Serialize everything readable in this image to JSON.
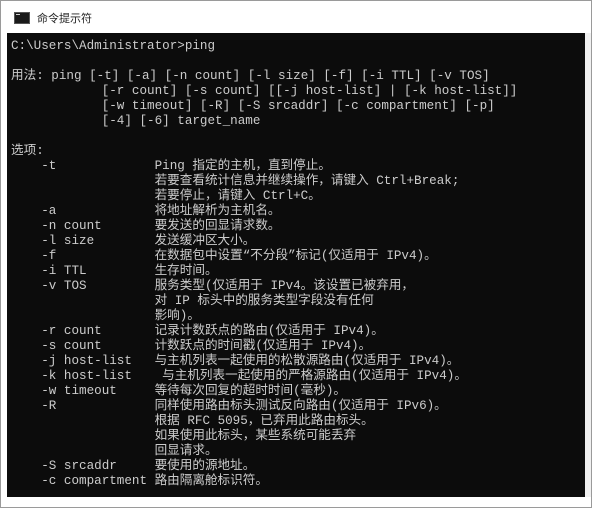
{
  "window": {
    "title": "命令提示符",
    "icon": "console-icon"
  },
  "console": {
    "lines": [
      "C:\\Users\\Administrator>ping",
      "",
      "用法: ping [-t] [-a] [-n count] [-l size] [-f] [-i TTL] [-v TOS]",
      "            [-r count] [-s count] [[-j host-list] | [-k host-list]]",
      "            [-w timeout] [-R] [-S srcaddr] [-c compartment] [-p]",
      "            [-4] [-6] target_name",
      "",
      "选项:",
      "    -t             Ping 指定的主机，直到停止。",
      "                   若要查看统计信息并继续操作，请键入 Ctrl+Break;",
      "                   若要停止，请键入 Ctrl+C。",
      "    -a             将地址解析为主机名。",
      "    -n count       要发送的回显请求数。",
      "    -l size        发送缓冲区大小。",
      "    -f             在数据包中设置“不分段”标记(仅适用于 IPv4)。",
      "    -i TTL         生存时间。",
      "    -v TOS         服务类型(仅适用于 IPv4。该设置已被弃用，",
      "                   对 IP 标头中的服务类型字段没有任何",
      "                   影响)。",
      "    -r count       记录计数跃点的路由(仅适用于 IPv4)。",
      "    -s count       计数跃点的时间戳(仅适用于 IPv4)。",
      "    -j host-list   与主机列表一起使用的松散源路由(仅适用于 IPv4)。",
      "    -k host-list    与主机列表一起使用的严格源路由(仅适用于 IPv4)。",
      "    -w timeout     等待每次回复的超时时间(毫秒)。",
      "    -R             同样使用路由标头测试反向路由(仅适用于 IPv6)。",
      "                   根据 RFC 5095，已弃用此路由标头。",
      "                   如果使用此标头，某些系统可能丢弃",
      "                   回显请求。",
      "    -S srcaddr     要使用的源地址。",
      "    -c compartment 路由隔离舱标识符。"
    ]
  }
}
